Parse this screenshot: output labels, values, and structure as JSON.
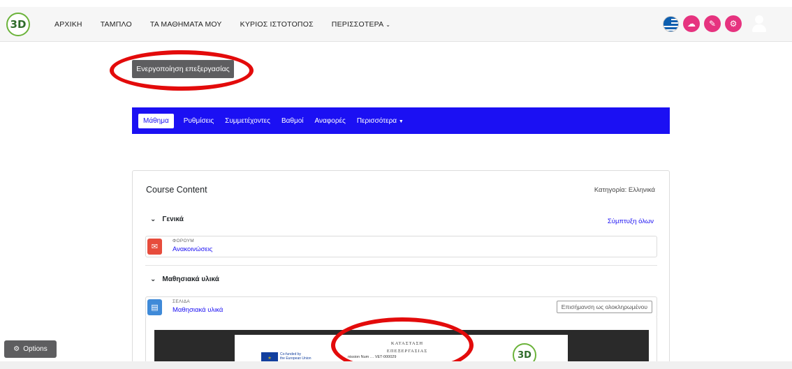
{
  "navbar": {
    "logo_text": "3D",
    "items": [
      {
        "label": "ΑΡΧΙΚΗ"
      },
      {
        "label": "ΤΑΜΠΛΟ"
      },
      {
        "label": "ΤΑ ΜΑΘΗΜΑΤΑ ΜΟΥ"
      },
      {
        "label": "ΚΥΡΙΟΣ ΙΣΤΟΤΟΠΟΣ"
      },
      {
        "label": "ΠΕΡΙΣΣΟΤΕΡΑ",
        "has_dropdown": true
      }
    ],
    "right_icons": [
      "greek-flag-icon",
      "pink-circle-icon",
      "pink-circle-icon",
      "pink-gear-icon",
      "user-avatar-icon"
    ]
  },
  "edit_mode_button": {
    "label": "Ενεργοποίηση επεξεργασίας"
  },
  "secondary_nav": {
    "tabs": [
      {
        "label": "Μάθημα",
        "active": true
      },
      {
        "label": "Ρυθμίσεις"
      },
      {
        "label": "Συμμετέχοντες"
      },
      {
        "label": "Βαθμοί"
      },
      {
        "label": "Αναφορές"
      },
      {
        "label": "Περισσότερα",
        "has_dropdown": true
      }
    ],
    "color": "#1b10f3"
  },
  "course": {
    "title": "Course Content",
    "category": "Κατηγορία: Ελληνικά",
    "collapse_all": "Σύμπτυξη όλων",
    "sections": [
      {
        "name": "Γενικά",
        "activities": [
          {
            "type": "ΦΟΡΟΥΜ",
            "name": "Ανακοινώσεις",
            "icon": "forum-icon",
            "icon_color": "#e74c3c"
          }
        ]
      },
      {
        "name": "Μαθησιακά υλικά",
        "activities": [
          {
            "type": "ΣΕΛΙΔΑ",
            "name": "Μαθησιακά υλικά",
            "icon": "page-icon",
            "icon_color": "#3f8ad8",
            "mark_button": "Επισήμανση ως ολοκληρωμένου"
          }
        ]
      }
    ],
    "embedded_doc": {
      "eu_text_line1": "Co-funded by",
      "eu_text_line2": "the European Union",
      "title_line1": "ΚΑΤΑΣΤΑΣΗ",
      "title_line2": "ΕΠΕΞΕΡΓΑΣΙΑΣ",
      "subtitle": "nission Num",
      "subtitle_tail": "VET-000029",
      "logo_text": "3D"
    }
  },
  "options_button": {
    "label": "Options"
  },
  "annotation_color": "#e30b0b"
}
